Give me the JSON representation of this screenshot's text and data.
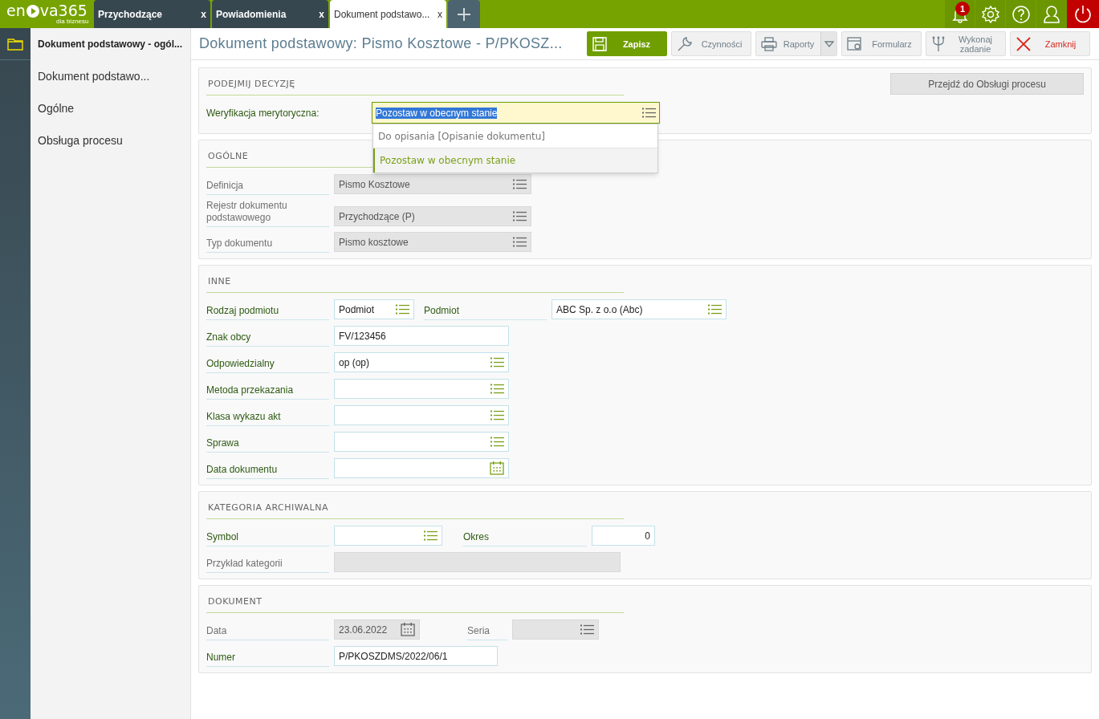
{
  "logo": {
    "word": "en",
    "word2": "va365",
    "tagline": "dla biznesu"
  },
  "tabs": [
    {
      "label": "Przychodzące",
      "close": "x",
      "selected": false
    },
    {
      "label": "Powiadomienia",
      "close": "x",
      "selected": false
    },
    {
      "label": "Dokument podstawo...",
      "close": "x",
      "selected": true
    }
  ],
  "notifications": {
    "count": "1"
  },
  "sidebar": {
    "items": [
      {
        "label": "Dokument podstawowy - ogól...",
        "selected": true
      },
      {
        "label": "Dokument podstawo...",
        "selected": false
      },
      {
        "label": "Ogólne",
        "selected": false
      },
      {
        "label": "Obsługa procesu",
        "selected": false
      }
    ]
  },
  "title": "Dokument podstawowy: Pismo Kosztowe - P/PKOSZ...",
  "toolbar": [
    {
      "label": "Zapisz",
      "kind": "primary"
    },
    {
      "label": "Czynności",
      "kind": "normal"
    },
    {
      "label": "Raporty",
      "kind": "split"
    },
    {
      "label": "Formularz",
      "kind": "normal"
    },
    {
      "label": "Wykonaj zadanie",
      "kind": "normal"
    },
    {
      "label": "Zamknij",
      "kind": "close"
    }
  ],
  "decision": {
    "heading": "PODEJMIJ DECYZJĘ",
    "label": "Weryfikacja merytoryczna:",
    "value": "Pozostaw w obecnym stanie",
    "button": "Przejdź do Obsługi procesu",
    "expanded": true,
    "options": [
      {
        "label": "Do opisania [Opisanie dokumentu]",
        "selected": false
      },
      {
        "label": "Pozostaw w obecnym stanie",
        "selected": true
      }
    ]
  },
  "sections": [
    {
      "heading": "OGÓLNE",
      "rows": [
        [
          {
            "label": "Definicja",
            "value": "Pismo Kosztowe",
            "kind": "list",
            "disabled": true
          }
        ],
        [
          {
            "label": "Rejestr dokumentu podstawowego",
            "value": "Przychodzące (P)",
            "kind": "list",
            "disabled": true
          }
        ],
        [
          {
            "label": "Typ dokumentu",
            "value": "Pismo kosztowe",
            "kind": "list",
            "disabled": true
          }
        ]
      ]
    },
    {
      "heading": "INNE",
      "rows": [
        [
          {
            "label": "Rodzaj podmiotu",
            "value": "Podmiot",
            "kind": "list",
            "disabled": false
          },
          {
            "label": "Podmiot",
            "value": "ABC Sp. z o.o (Abc)",
            "kind": "list",
            "disabled": false
          }
        ],
        [
          {
            "label": "Znak obcy",
            "value": "FV/123456",
            "kind": "text",
            "disabled": false
          }
        ],
        [
          {
            "label": "Odpowiedzialny",
            "value": "op (op)",
            "kind": "list",
            "disabled": false
          }
        ],
        [
          {
            "label": "Metoda przekazania",
            "kind": "list",
            "disabled": false
          }
        ],
        [
          {
            "label": "Klasa wykazu akt",
            "kind": "list",
            "disabled": false
          }
        ],
        [
          {
            "label": "Sprawa",
            "kind": "list",
            "disabled": false
          }
        ],
        [
          {
            "label": "Data dokumentu",
            "kind": "date",
            "disabled": false
          }
        ]
      ]
    },
    {
      "heading": "KATEGORIA ARCHIWALNA",
      "rows": [
        [
          {
            "label": "Symbol",
            "kind": "list",
            "disabled": false
          },
          {
            "label": "Okres",
            "value": "0",
            "kind": "number",
            "disabled": false
          }
        ],
        [
          {
            "label": "Przykład kategorii",
            "kind": "text",
            "disabled": true
          }
        ]
      ]
    },
    {
      "heading": "DOKUMENT",
      "rows": [
        [
          {
            "label": "Data",
            "value": "23.06.2022",
            "kind": "date",
            "disabled": true
          },
          {
            "label": "Seria",
            "kind": "list",
            "disabled": true
          }
        ],
        [
          {
            "label": "Numer",
            "value": "P/PKOSZDMS/2022/06/1",
            "kind": "text",
            "disabled": false
          }
        ]
      ]
    }
  ]
}
